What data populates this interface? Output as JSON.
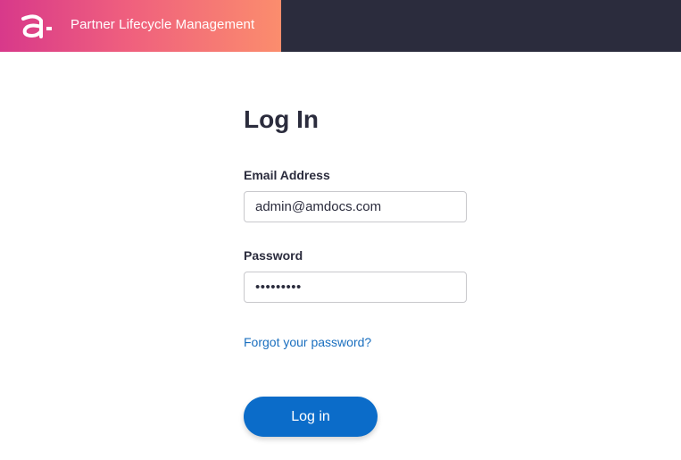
{
  "header": {
    "brand_title": "Partner Lifecycle Management",
    "logo_icon": "amdocs-logo-icon",
    "gradient_start": "#d8398a",
    "gradient_end": "#fb8d6d",
    "bar_color": "#2b2c3d"
  },
  "login": {
    "title": "Log In",
    "email_label": "Email Address",
    "email_value": "admin@amdocs.com",
    "password_label": "Password",
    "password_value": "•••••••••",
    "forgot_link": "Forgot your password?",
    "submit_label": "Log in",
    "accent_color": "#0b6cc9"
  }
}
